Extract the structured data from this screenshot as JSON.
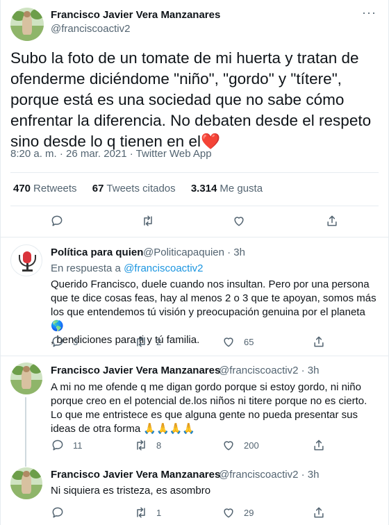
{
  "main_tweet": {
    "author_name": "Francisco Javier Vera Manzanares",
    "author_handle": "@franciscoactiv2",
    "more": "···",
    "text": "Subo la foto de un tomate de mi huerta y tratan de ofenderme diciéndome \"niño\", \"gordo\" y \"títere\", porque está es una sociedad que no sabe cómo enfrentar la diferencia. No debaten desde el respeto sino desde lo q tienen en el",
    "heart_emoji": "❤️",
    "meta": "8:20 a. m. · 26 mar. 2021 · Twitter Web App",
    "stats": {
      "retweets_num": "470",
      "retweets_lbl": "Retweets",
      "quotes_num": "67",
      "quotes_lbl": "Tweets citados",
      "likes_num": "3.314",
      "likes_lbl": "Me gusta"
    }
  },
  "replies": [
    {
      "author_name": "Política para quien",
      "author_handle": "@Politicapaquien · 3h",
      "reply_label": "En respuesta a",
      "reply_target": "@franciscoactiv2",
      "line1": "Querido Francisco, duele cuando nos insultan. Pero por una persona",
      "line2": "que te dice cosas feas, hay al menos 2 o 3 que te apoyan, somos más",
      "line3": "los que entendemos tú visión y preocupación genuina por el planeta 🌎",
      "line4": ", bendiciones para ti y tú familia.",
      "replies": "3",
      "retweets": "2",
      "likes": "65"
    },
    {
      "author_name": "Francisco Javier Vera Manzanares",
      "author_handle": "@franciscoactiv2 · 3h",
      "line1": "A mi no me ofende q me digan gordo porque si estoy gordo, ni niño",
      "line2": "porque creo en el potencial de.los niños ni titere porque no es cierto.",
      "line3": "Lo que me entristece es que alguna gente no pueda presentar sus",
      "line4": "ideas de otra forma 🙏🙏🙏🙏",
      "replies": "11",
      "retweets": "8",
      "likes": "200"
    },
    {
      "author_name": "Francisco Javier Vera Manzanares",
      "author_handle": "@franciscoactiv2 · 3h",
      "line1": "Ni siquiera es tristeza, es asombro",
      "retweets": "1",
      "likes": "29"
    }
  ],
  "icons": [
    "reply-icon",
    "retweet-icon",
    "like-icon",
    "share-icon",
    "more-icon"
  ],
  "colors": {
    "link": "#1b95e0",
    "secondary": "#536471",
    "heart": "#e0245e",
    "divider": "#e6ecf0"
  }
}
